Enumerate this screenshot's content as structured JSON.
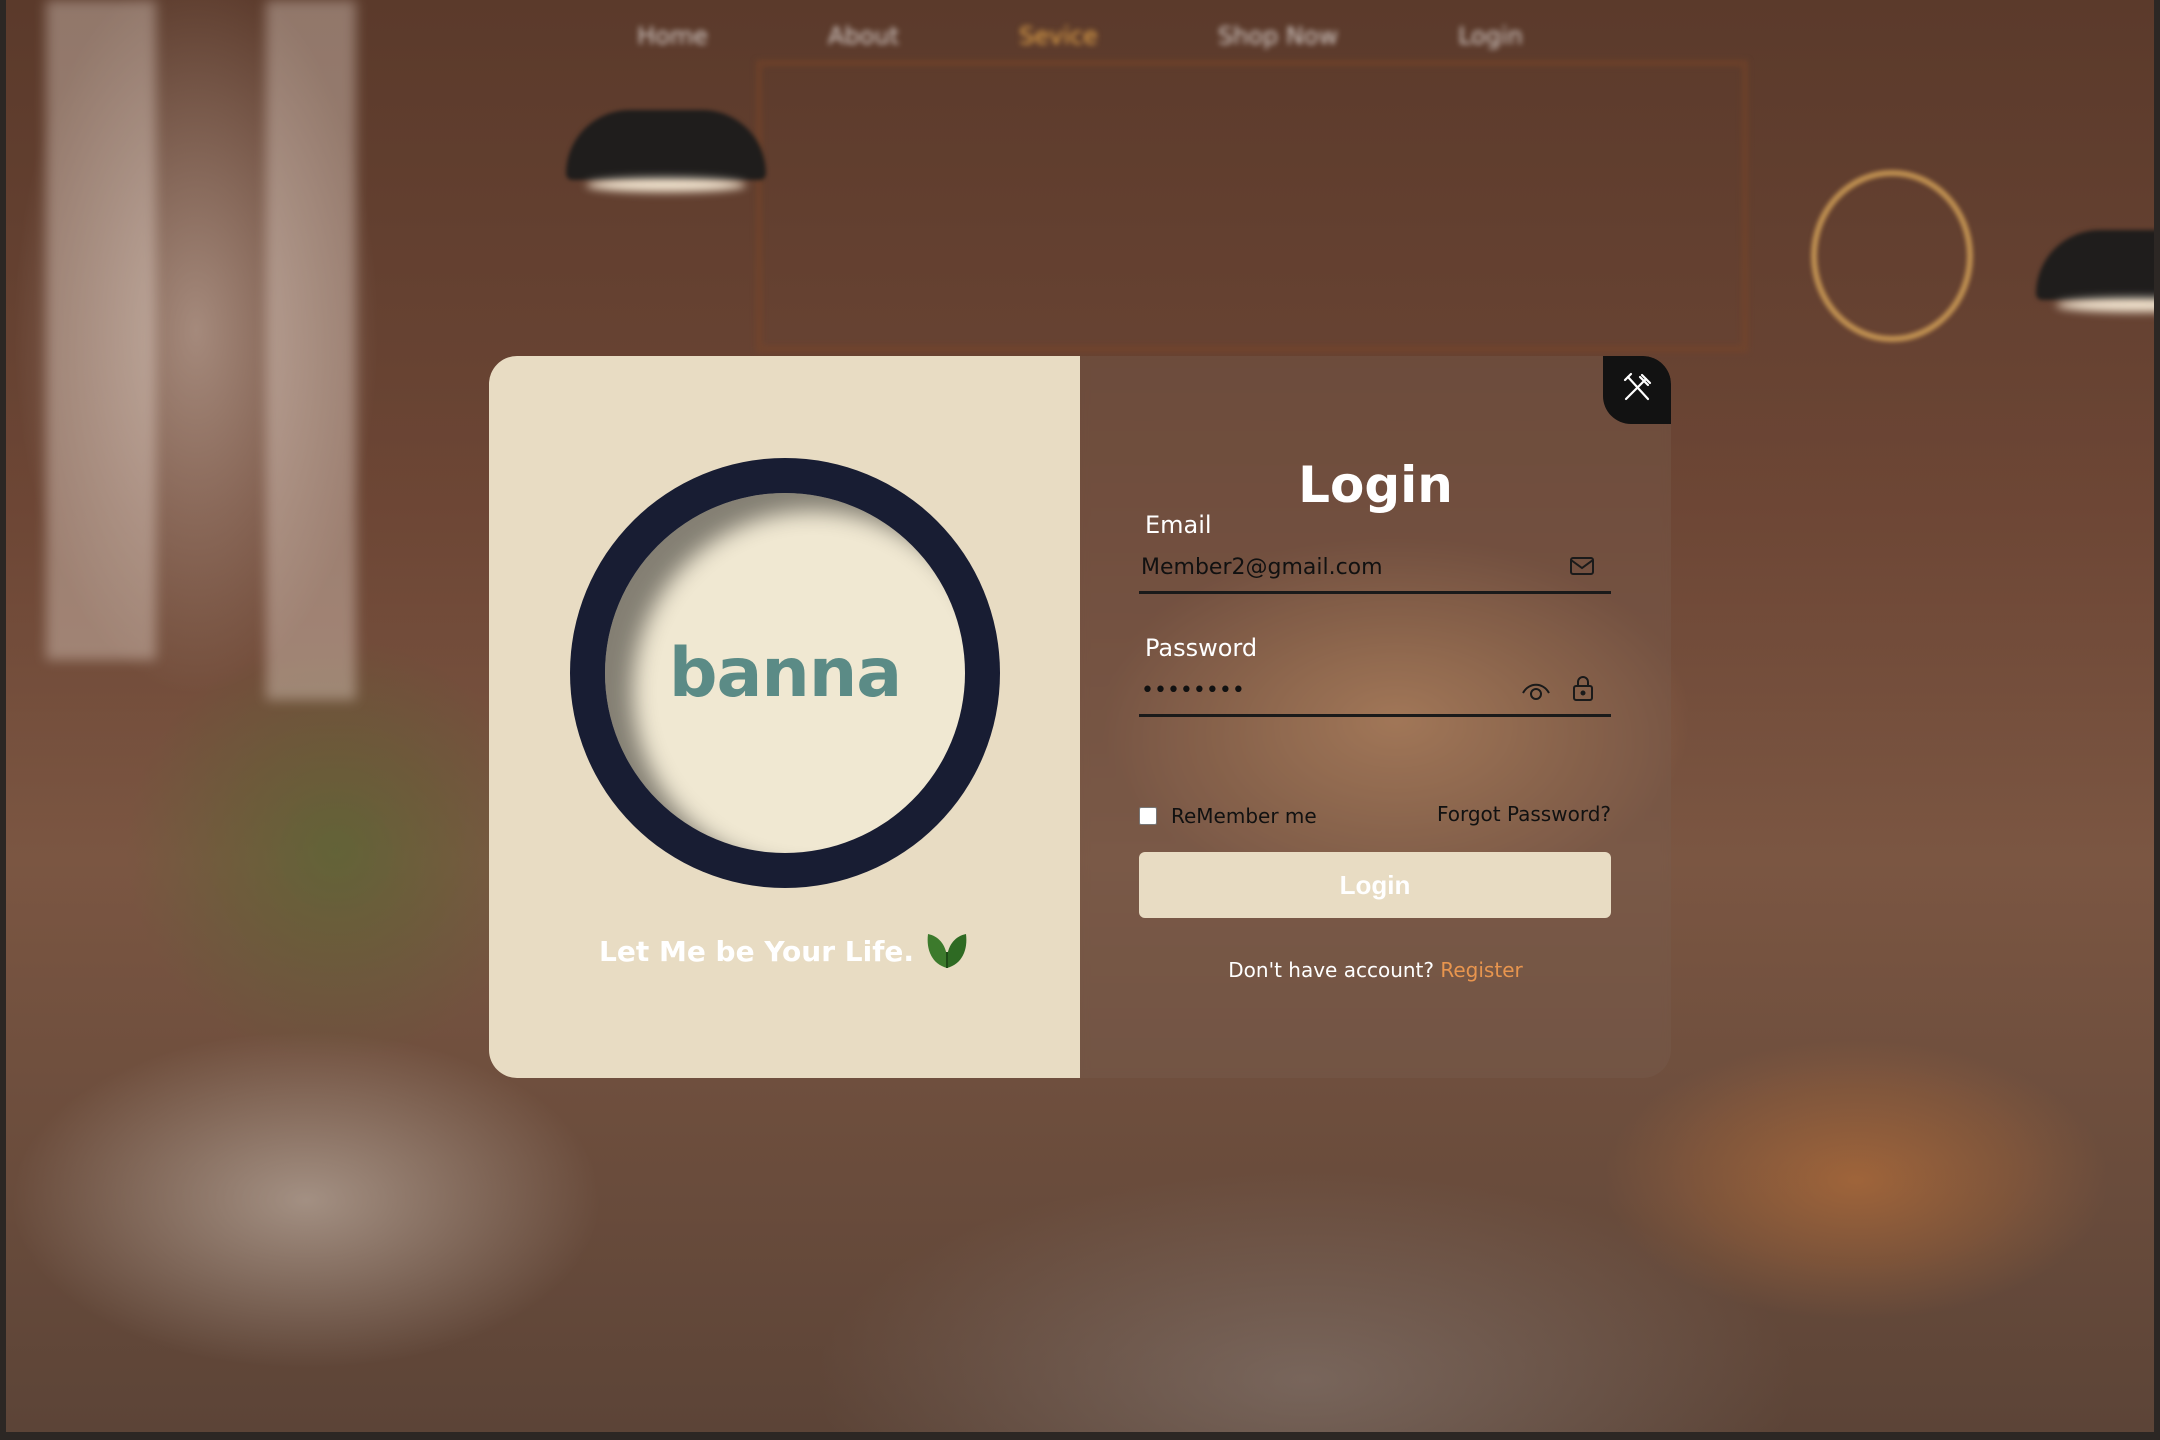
{
  "nav": {
    "items": [
      "Home",
      "About",
      "Sevice",
      "Shop Now",
      "Login"
    ],
    "active_index": 2
  },
  "brand": {
    "name": "banna",
    "tagline": "Let Me be Your Life."
  },
  "login_form": {
    "title": "Login",
    "email_label": "Email",
    "email_value": "Member2@gmail.com",
    "password_label": "Password",
    "password_value": "••••••••",
    "remember_label": "ReMember me",
    "forgot_label": "Forgot Password?",
    "submit_label": "Login",
    "register_prompt": "Don't have account?",
    "register_link": "Register"
  },
  "icons": {
    "corner": "utensils-icon",
    "email": "mail-icon",
    "password_visibility": "eye-icon",
    "password_lock": "lock-icon",
    "tagline": "leaf-icon"
  },
  "colors": {
    "panel_beige": "#e8dcc3",
    "ring_navy": "#181d33",
    "brand_teal": "#5b8b86",
    "register_orange": "#e8954e"
  }
}
